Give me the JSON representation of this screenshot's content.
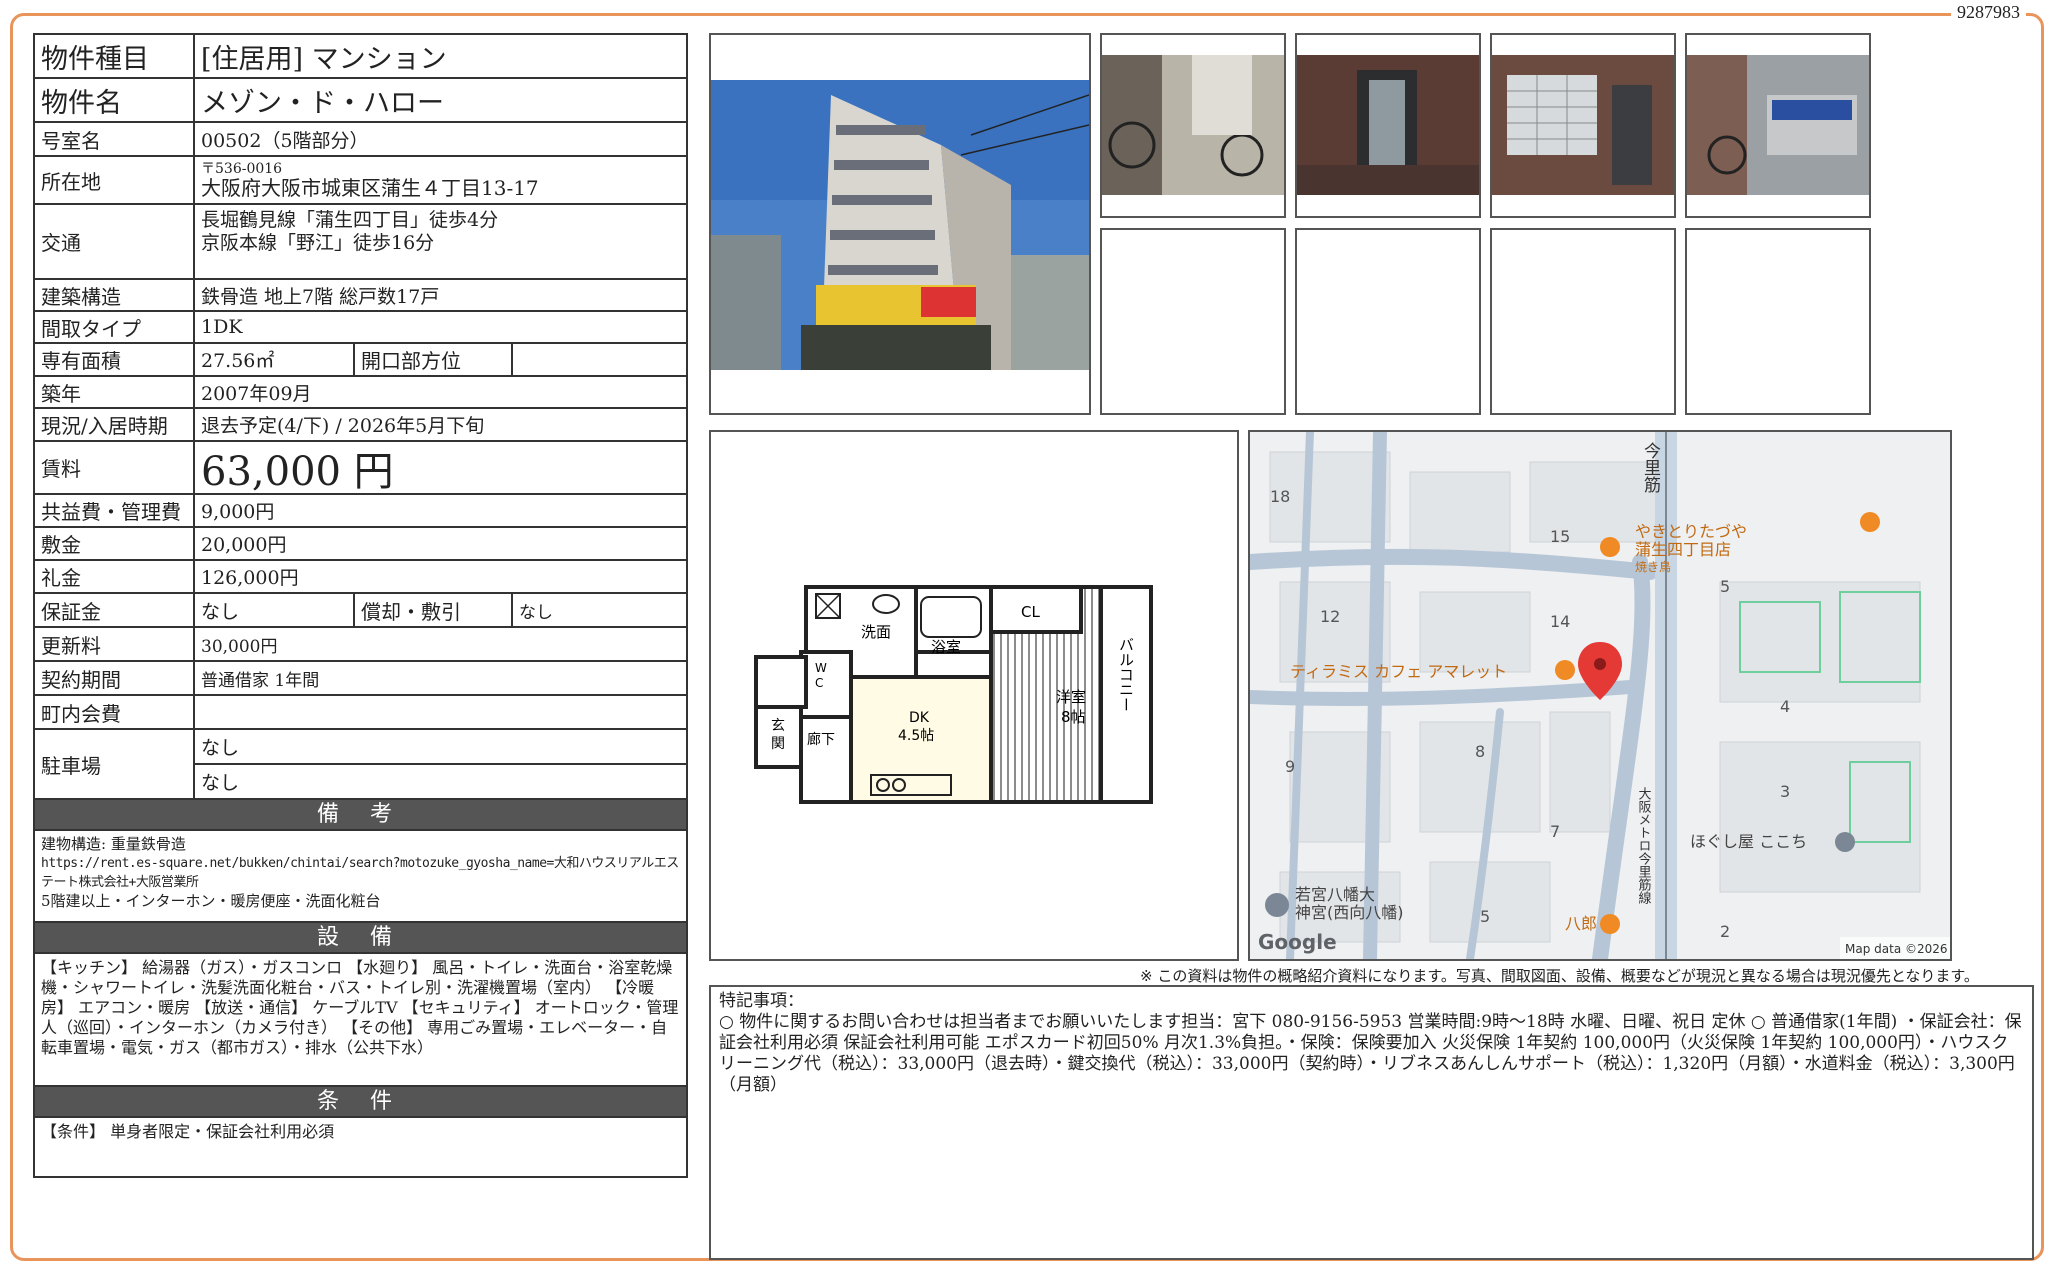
{
  "doc_id": "9287983",
  "property": {
    "type_label": "物件種目",
    "type_value": "[住居用] マンション",
    "name_label": "物件名",
    "name_value": "メゾン・ド・ハロー",
    "room_label": "号室名",
    "room_value": "00502（5階部分）",
    "address_label": "所在地",
    "address_zip": "〒536-0016",
    "address_value": "大阪府大阪市城東区蒲生４丁目13-17",
    "transport_label": "交通",
    "transport_1": "長堀鶴見線「蒲生四丁目」徒歩4分",
    "transport_2": "京阪本線「野江」徒歩16分",
    "structure_label": "建築構造",
    "structure_value": "鉄骨造 地上7階 総戸数17戸",
    "layout_label": "間取タイプ",
    "layout_value": "1DK",
    "area_label": "専有面積",
    "area_value": "27.56㎡",
    "direction_label": "開口部方位",
    "direction_value": "",
    "built_label": "築年",
    "built_value": "2007年09月",
    "status_label": "現況/入居時期",
    "status_value": "退去予定(4/下) / 2026年5月下旬",
    "rent_label": "賃料",
    "rent_value": "63,000 円",
    "fee_label": "共益費・管理費",
    "fee_value": "9,000円",
    "deposit_label": "敷金",
    "deposit_value": "20,000円",
    "key_money_label": "礼金",
    "key_money_value": "126,000円",
    "guarantee_label": "保証金",
    "guarantee_value": "なし",
    "amort_label": "償却・敷引",
    "amort_value": "なし",
    "renewal_label": "更新料",
    "renewal_value": "30,000円",
    "contract_label": "契約期間",
    "contract_value": "普通借家 1年間",
    "community_label": "町内会費",
    "community_value": "",
    "parking_label": "駐車場",
    "parking_1": "なし",
    "parking_2": "なし"
  },
  "sections": {
    "remarks_title": "備 考",
    "remarks_lines": [
      "建物構造: 重量鉄骨造",
      "https://rent.es-square.net/bukken/chintai/search?motozuke_gyosha_name=大和ハウスリアルエステート株式会社+大阪営業所",
      "5階建以上・インターホン・暖房便座・洗面化粧台"
    ],
    "equipment_title": "設 備",
    "equipment_text": "【キッチン】 給湯器（ガス）・ガスコンロ 【水廻り】 風呂・トイレ・洗面台・浴室乾燥機・シャワートイレ・洗髪洗面化粧台・バス・トイレ別・洗濯機置場（室内） 【冷暖房】 エアコン・暖房 【放送・通信】 ケーブルTV 【セキュリティ】 オートロック・管理人（巡回）・インターホン（カメラ付き） 【その他】 専用ごみ置場・エレベーター・自転車置場・電気・ガス（都市ガス）・排水（公共下水）",
    "conditions_title": "条 件",
    "conditions_text": "【条件】 単身者限定・保証会社利用必須"
  },
  "floorplan": {
    "wash": "洗面",
    "bath": "浴室",
    "cl": "CL",
    "wc_1": "W",
    "wc_2": "C",
    "entrance_1": "玄",
    "entrance_2": "関",
    "hall": "廊下",
    "dk_1": "DK",
    "dk_2": "4.5帖",
    "western_1": "洋室",
    "western_2": "8帖",
    "balcony": "バルコニー"
  },
  "map": {
    "labels": [
      "18",
      "15",
      "12",
      "14",
      "5",
      "4",
      "9",
      "8",
      "3",
      "7",
      "5",
      "2"
    ],
    "street": "今里筋",
    "subway": "大阪メトロ今里筋線",
    "poi_1": "やきとりたづや",
    "poi_1b": "蒲生四丁目店",
    "poi_1c": "焼き鳥",
    "poi_2": "ティラミス カフェ アマレット",
    "poi_3": "ほぐし屋 ここち",
    "poi_4a": "若宮八幡大",
    "poi_4b": "神宮(西向八幡)",
    "poi_5": "八郎",
    "google": "Google",
    "credit": "Map data ©2026"
  },
  "footnote": "※ この資料は物件の概略紹介資料になります。写真、間取図面、設備、概要などが現況と異なる場合は現況優先となります。",
  "special": {
    "title": "特記事項：",
    "text": "○ 物件に関するお問い合わせは担当者までお願いいたします担当：宮下 080-9156-5953 営業時間:9時～18時 水曜、日曜、祝日 定休 ○ 普通借家(1年間) ・保証会社：保証会社利用必須 保証会社利用可能 エポスカード初回50% 月次1.3%負担。・保険：保険要加入 火災保険 1年契約 100,000円（火災保険 1年契約 100,000円）・ハウスクリーニング代（税込）：33,000円（退去時）・鍵交換代（税込）：33,000円（契約時）・リブネスあんしんサポート（税込）：1,320円（月額）・水道料金（税込）：3,300円（月額）"
  },
  "colors": {
    "frame": "#e8945a",
    "section": "#555555",
    "map_pin": "#e53935",
    "poi": "#f08a24"
  }
}
